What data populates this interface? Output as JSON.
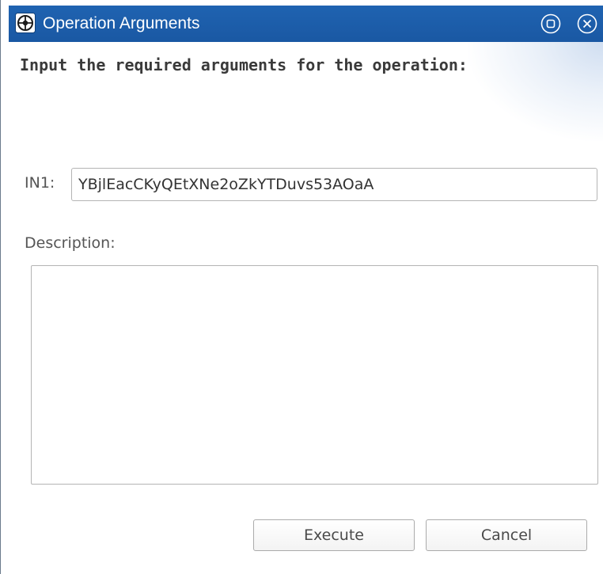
{
  "window": {
    "title": "Operation Arguments",
    "title_bar_color": "#1d5eaa",
    "app_icon": "operation-icon",
    "controls": {
      "restore_icon": "restore-icon",
      "close_icon": "close-icon"
    }
  },
  "form": {
    "heading": "Input the required arguments for the operation:",
    "arguments": [
      {
        "label": "IN1:",
        "value": "YBjlEacCKyQEtXNe2oZkYTDuvs53AOaA"
      }
    ],
    "description_label": "Description:",
    "description_value": ""
  },
  "actions": {
    "execute_label": "Execute",
    "cancel_label": "Cancel"
  }
}
